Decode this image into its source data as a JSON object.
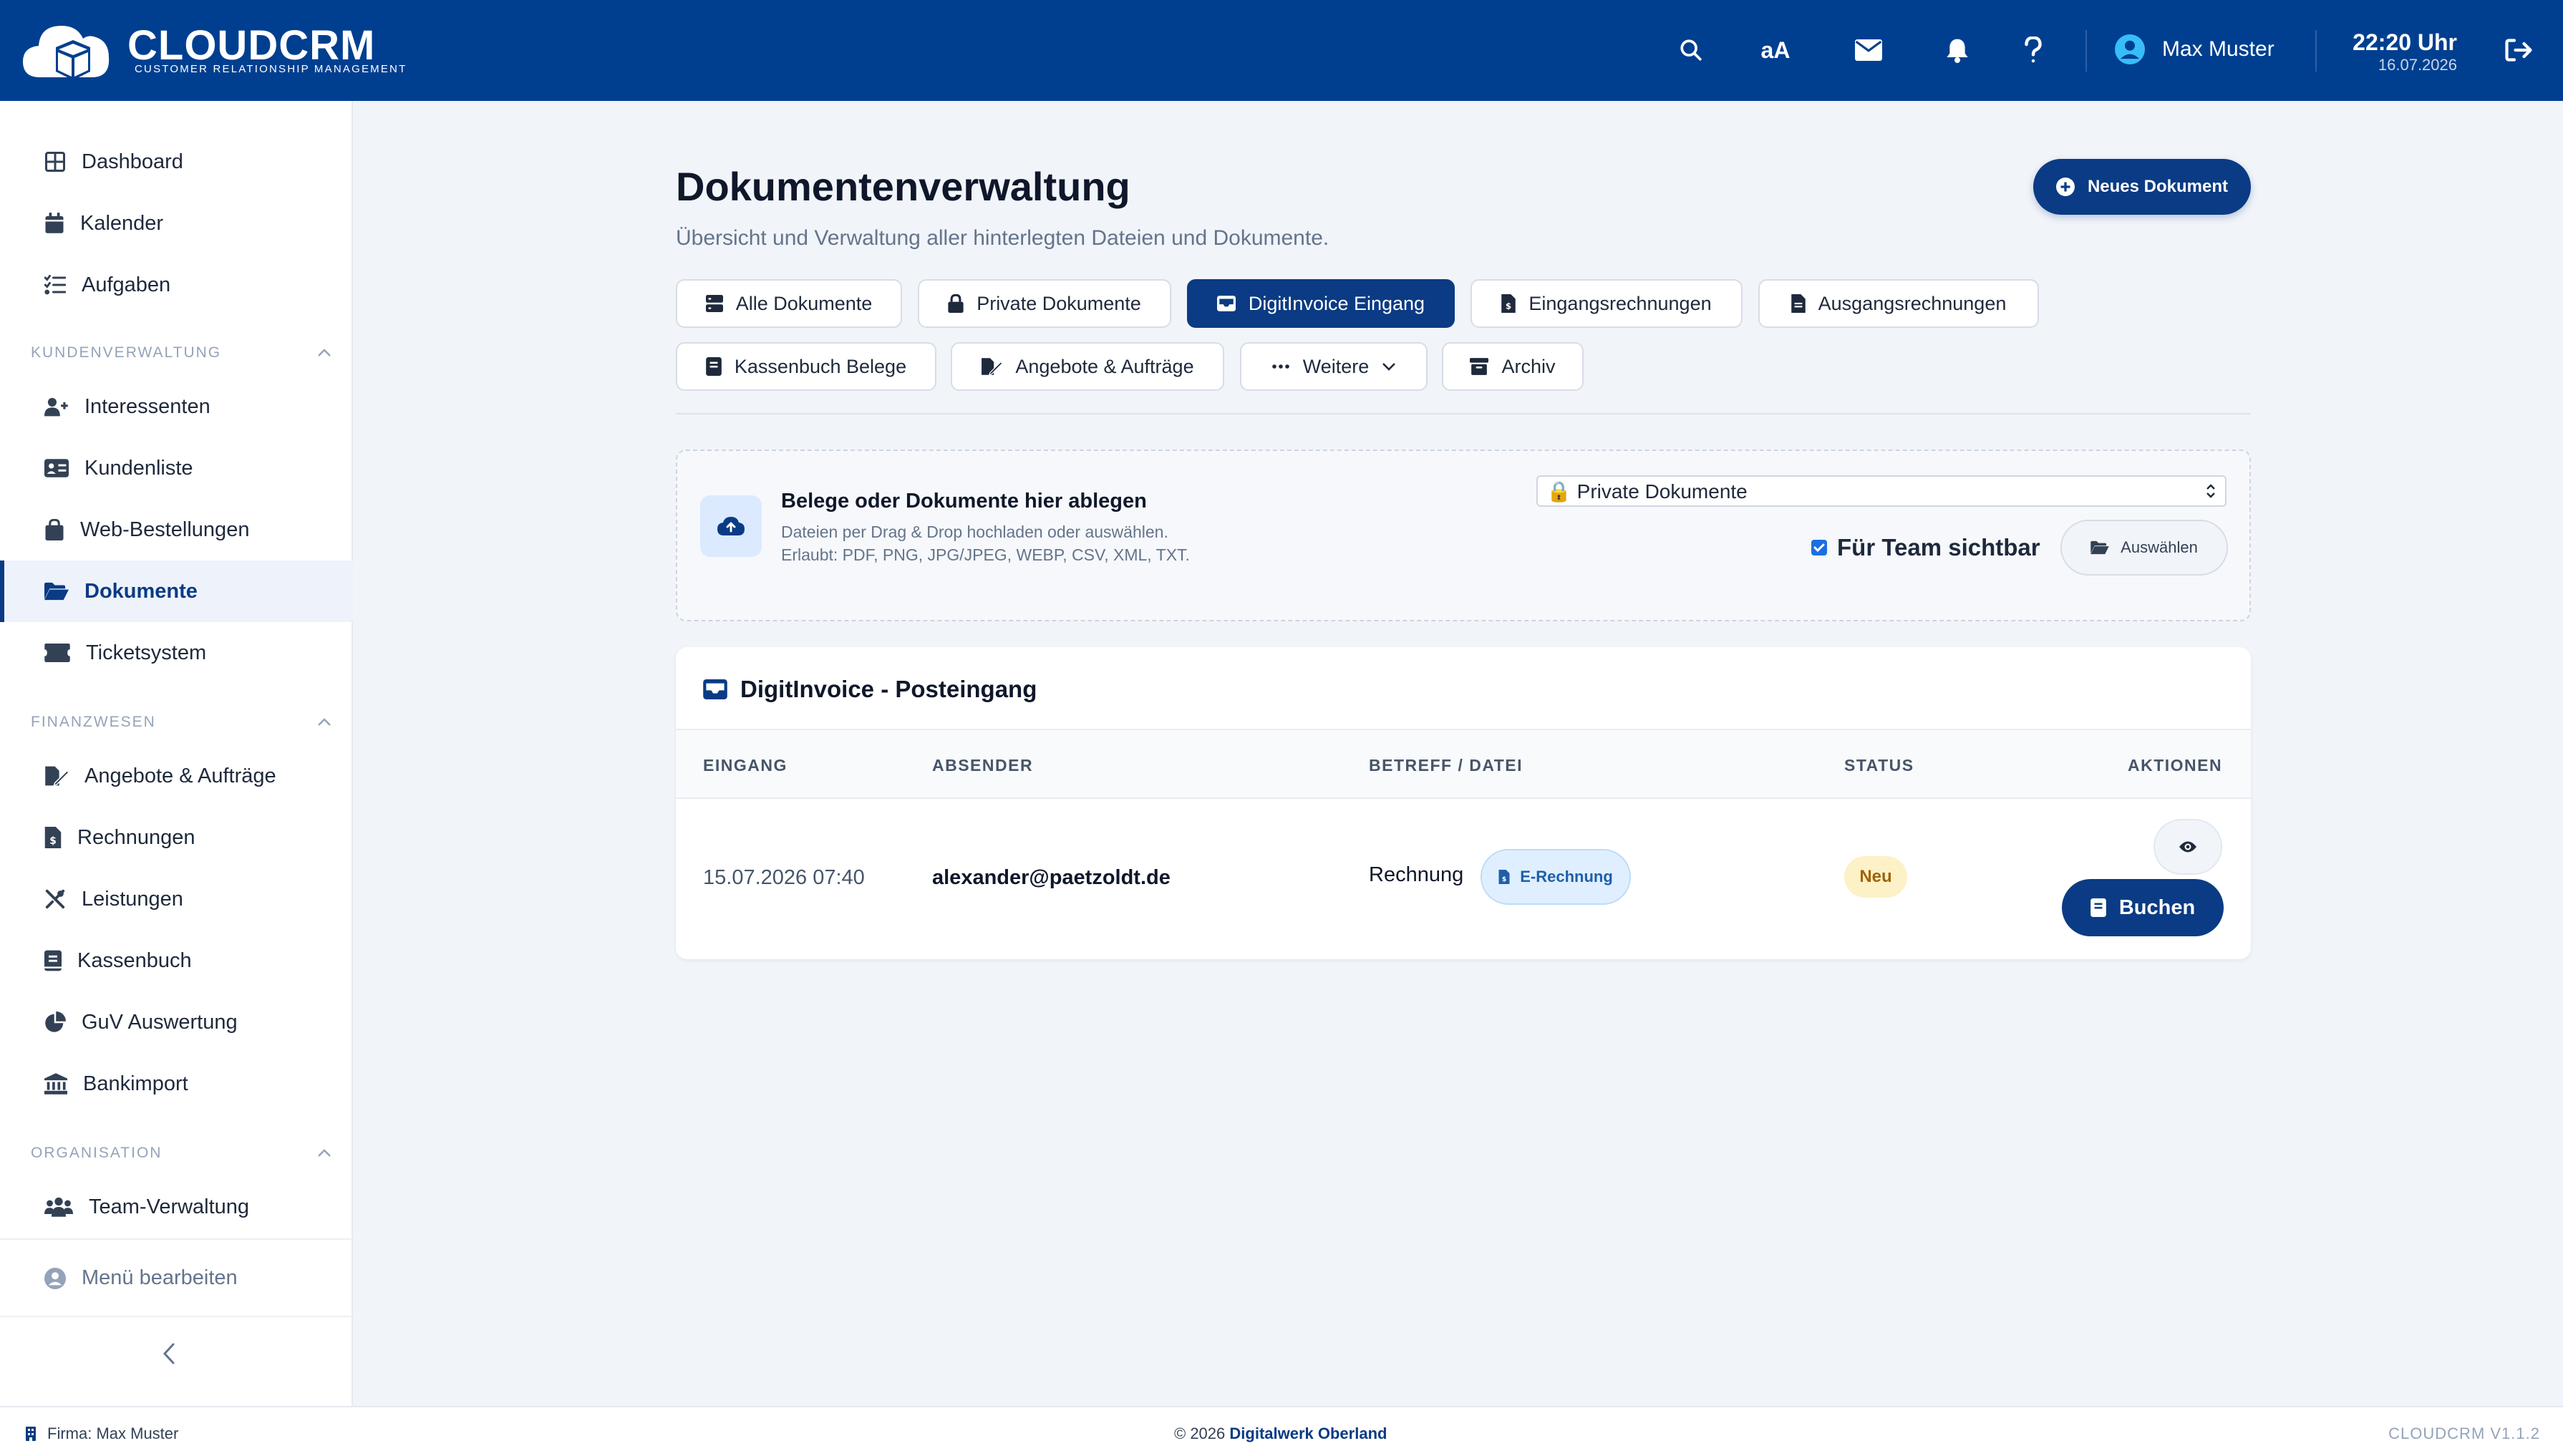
{
  "app": {
    "name": "CLOUDCRM",
    "tagline": "CUSTOMER RELATIONSHIP MANAGEMENT"
  },
  "header": {
    "text_size_label": "aA",
    "user_name": "Max Muster",
    "time": "22:20 Uhr",
    "date": "16.07.2026",
    "icons": [
      "search-icon",
      "text-size-icon",
      "mail-icon",
      "bell-icon",
      "help-icon",
      "user-avatar-icon",
      "logout-icon"
    ]
  },
  "sidebar": {
    "top": [
      {
        "label": "Dashboard",
        "icon": "grid-icon"
      },
      {
        "label": "Kalender",
        "icon": "calendar-icon"
      },
      {
        "label": "Aufgaben",
        "icon": "tasks-icon"
      }
    ],
    "section_kunden": "KUNDENVERWALTUNG",
    "kunden": [
      {
        "label": "Interessenten",
        "icon": "user-plus-icon"
      },
      {
        "label": "Kundenliste",
        "icon": "id-card-icon"
      },
      {
        "label": "Web-Bestellungen",
        "icon": "shopping-bag-icon"
      },
      {
        "label": "Dokumente",
        "icon": "folder-open-icon",
        "active": true
      },
      {
        "label": "Ticketsystem",
        "icon": "ticket-icon"
      }
    ],
    "section_finanz": "FINANZWESEN",
    "finanz": [
      {
        "label": "Angebote & Aufträge",
        "icon": "file-signature-icon"
      },
      {
        "label": "Rechnungen",
        "icon": "invoice-icon"
      },
      {
        "label": "Leistungen",
        "icon": "tools-icon"
      },
      {
        "label": "Kassenbuch",
        "icon": "book-icon"
      },
      {
        "label": "GuV Auswertung",
        "icon": "pie-chart-icon"
      },
      {
        "label": "Bankimport",
        "icon": "bank-icon"
      }
    ],
    "section_org": "ORGANISATION",
    "org": [
      {
        "label": "Team-Verwaltung",
        "icon": "users-icon"
      }
    ],
    "menu_edit": "Menü bearbeiten"
  },
  "page": {
    "title": "Dokumentenverwaltung",
    "subtitle": "Übersicht und Verwaltung aller hinterlegten Dateien und Dokumente.",
    "new_button": "Neues Dokument"
  },
  "tabs": [
    {
      "label": "Alle Dokumente",
      "icon": "stack-icon"
    },
    {
      "label": "Private Dokumente",
      "icon": "lock-icon"
    },
    {
      "label": "DigitInvoice Eingang",
      "icon": "inbox-icon",
      "active": true
    },
    {
      "label": "Eingangsrechnungen",
      "icon": "invoice-icon"
    },
    {
      "label": "Ausgangsrechnungen",
      "icon": "file-icon"
    },
    {
      "label": "Kassenbuch Belege",
      "icon": "book-icon"
    },
    {
      "label": "Angebote & Aufträge",
      "icon": "file-signature-icon"
    },
    {
      "label": "Weitere",
      "icon": "more-icon"
    },
    {
      "label": "Archiv",
      "icon": "archive-icon"
    }
  ],
  "upload": {
    "heading": "Belege oder Dokumente hier ablegen",
    "line1": "Dateien per Drag & Drop hochladen oder auswählen.",
    "line2": "Erlaubt: PDF, PNG, JPG/JPEG, WEBP, CSV, XML, TXT.",
    "target_select": "🔒 Private Dokumente",
    "team_visible_label": "Für Team sichtbar",
    "team_visible_checked": true,
    "choose_button": "Auswählen"
  },
  "inbox": {
    "title": "DigitInvoice - Posteingang",
    "columns": [
      "EINGANG",
      "ABSENDER",
      "BETREFF / DATEI",
      "STATUS",
      "AKTIONEN"
    ],
    "rows": [
      {
        "received": "15.07.2026 07:40",
        "sender": "alexander@paetzoldt.de",
        "subject": "Rechnung",
        "badge": "E-Rechnung",
        "status": "Neu",
        "book_button": "Buchen"
      }
    ]
  },
  "footer": {
    "company": "Firma: Max Muster",
    "copyright": "© 2026",
    "vendor": "Digitalwerk Oberland",
    "version": "CLOUDCRM V1.1.2"
  },
  "colors": {
    "primary": "#003f90",
    "accent": "#0a3b84",
    "background": "#f1f4f9",
    "badge_new": "#fdf1c7",
    "badge_einvoice": "#e0efff"
  }
}
